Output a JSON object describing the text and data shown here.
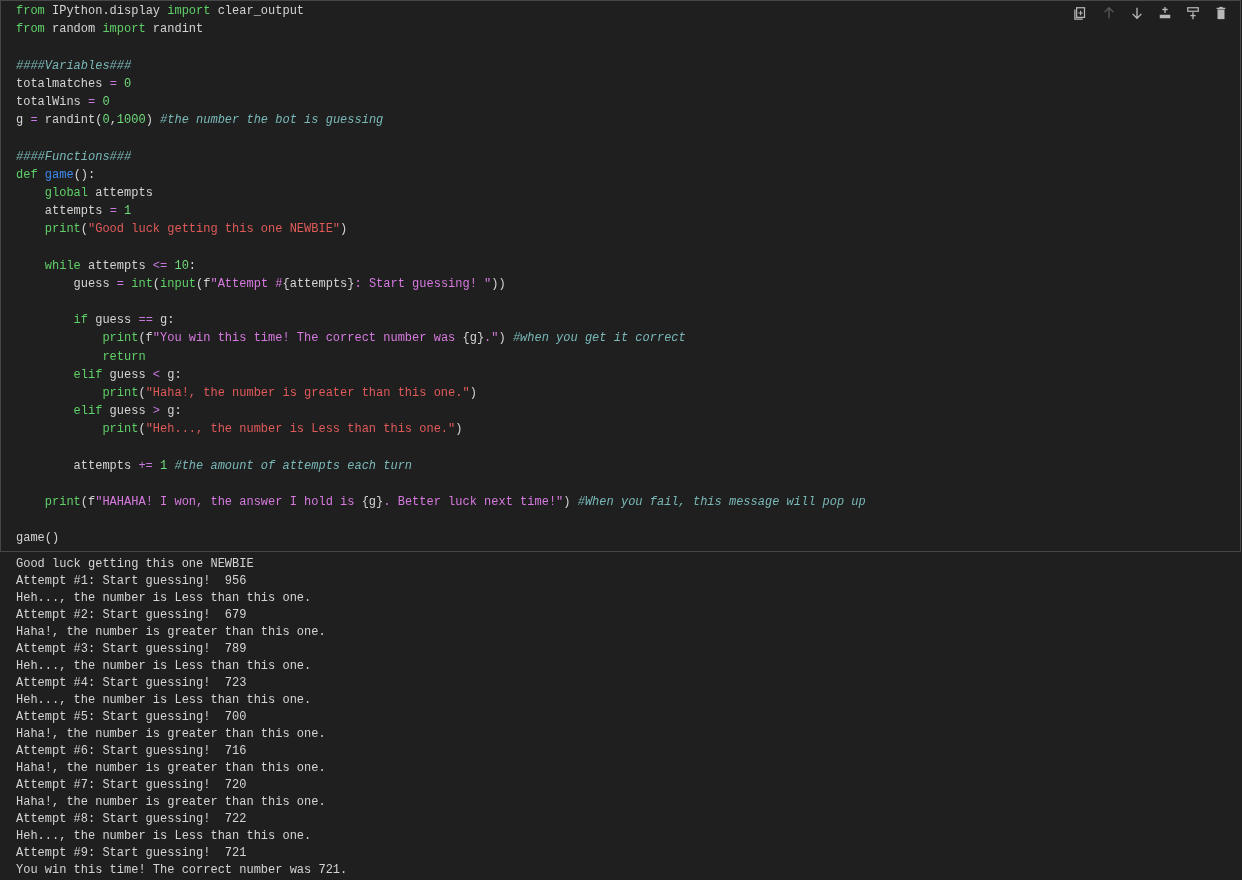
{
  "cell_toolbar": [
    {
      "kind": "copy",
      "disabled": false
    },
    {
      "kind": "move-up",
      "disabled": true
    },
    {
      "kind": "move-down",
      "disabled": false
    },
    {
      "kind": "insert-above",
      "disabled": false
    },
    {
      "kind": "insert-below",
      "disabled": false
    },
    {
      "kind": "delete",
      "disabled": false
    }
  ],
  "code_lines": [
    {
      "kind": "code",
      "tokens": [
        {
          "kind": "kw",
          "text": "from"
        },
        {
          "kind": "plain",
          "text": " IPython.display "
        },
        {
          "kind": "kw",
          "text": "import"
        },
        {
          "kind": "plain",
          "text": " clear_output"
        }
      ]
    },
    {
      "kind": "code",
      "tokens": [
        {
          "kind": "kw",
          "text": "from"
        },
        {
          "kind": "plain",
          "text": " random "
        },
        {
          "kind": "kw",
          "text": "import"
        },
        {
          "kind": "plain",
          "text": " randint"
        }
      ]
    },
    {
      "kind": "blank"
    },
    {
      "kind": "code",
      "tokens": [
        {
          "kind": "comment",
          "text": "####Variables###"
        }
      ]
    },
    {
      "kind": "code",
      "tokens": [
        {
          "kind": "plain",
          "text": "totalmatches "
        },
        {
          "kind": "op",
          "text": "="
        },
        {
          "kind": "num",
          "text": " 0"
        }
      ]
    },
    {
      "kind": "code",
      "tokens": [
        {
          "kind": "plain",
          "text": "totalWins "
        },
        {
          "kind": "op",
          "text": "="
        },
        {
          "kind": "num",
          "text": " 0"
        }
      ]
    },
    {
      "kind": "code",
      "tokens": [
        {
          "kind": "plain",
          "text": "g "
        },
        {
          "kind": "op",
          "text": "="
        },
        {
          "kind": "plain",
          "text": " randint("
        },
        {
          "kind": "num",
          "text": "0"
        },
        {
          "kind": "plain",
          "text": ","
        },
        {
          "kind": "num",
          "text": "1000"
        },
        {
          "kind": "plain",
          "text": ") "
        },
        {
          "kind": "comment",
          "text": "#the number the bot is guessing"
        }
      ]
    },
    {
      "kind": "blank"
    },
    {
      "kind": "code",
      "tokens": [
        {
          "kind": "comment",
          "text": "####Functions###"
        }
      ]
    },
    {
      "kind": "code",
      "tokens": [
        {
          "kind": "kw",
          "text": "def"
        },
        {
          "kind": "fn",
          "text": " game"
        },
        {
          "kind": "plain",
          "text": "():"
        }
      ]
    },
    {
      "kind": "code",
      "tokens": [
        {
          "kind": "kw",
          "text": "    global"
        },
        {
          "kind": "plain",
          "text": " attempts"
        }
      ]
    },
    {
      "kind": "code",
      "tokens": [
        {
          "kind": "plain",
          "text": "    attempts "
        },
        {
          "kind": "op",
          "text": "="
        },
        {
          "kind": "num",
          "text": " 1"
        }
      ]
    },
    {
      "kind": "code",
      "tokens": [
        {
          "kind": "kw",
          "text": "    print"
        },
        {
          "kind": "plain",
          "text": "("
        },
        {
          "kind": "str",
          "text": "\"Good luck getting this one NEWBIE\""
        },
        {
          "kind": "plain",
          "text": ")"
        }
      ]
    },
    {
      "kind": "blank"
    },
    {
      "kind": "code",
      "tokens": [
        {
          "kind": "kw",
          "text": "    while"
        },
        {
          "kind": "plain",
          "text": " attempts "
        },
        {
          "kind": "op",
          "text": "<="
        },
        {
          "kind": "num",
          "text": " 10"
        },
        {
          "kind": "plain",
          "text": ":"
        }
      ]
    },
    {
      "kind": "code",
      "tokens": [
        {
          "kind": "plain",
          "text": "        guess "
        },
        {
          "kind": "op",
          "text": "="
        },
        {
          "kind": "kw",
          "text": " int"
        },
        {
          "kind": "plain",
          "text": "("
        },
        {
          "kind": "kw",
          "text": "input"
        },
        {
          "kind": "plain",
          "text": "(f"
        },
        {
          "kind": "fstr",
          "text": "\"Attempt #"
        },
        {
          "kind": "plain",
          "text": "{attempts}"
        },
        {
          "kind": "fstr",
          "text": ": Start guessing! \""
        },
        {
          "kind": "plain",
          "text": "))"
        }
      ]
    },
    {
      "kind": "blank"
    },
    {
      "kind": "code",
      "tokens": [
        {
          "kind": "kw",
          "text": "        if"
        },
        {
          "kind": "plain",
          "text": " guess "
        },
        {
          "kind": "op",
          "text": "=="
        },
        {
          "kind": "plain",
          "text": " g:"
        }
      ]
    },
    {
      "kind": "code",
      "tokens": [
        {
          "kind": "kw",
          "text": "            print"
        },
        {
          "kind": "plain",
          "text": "(f"
        },
        {
          "kind": "fstr",
          "text": "\"You win this time! The correct number was "
        },
        {
          "kind": "plain",
          "text": "{g}"
        },
        {
          "kind": "fstr",
          "text": ".\""
        },
        {
          "kind": "plain",
          "text": ") "
        },
        {
          "kind": "comment",
          "text": "#when you get it correct"
        }
      ]
    },
    {
      "kind": "code",
      "tokens": [
        {
          "kind": "kw",
          "text": "            return"
        }
      ]
    },
    {
      "kind": "code",
      "tokens": [
        {
          "kind": "kw",
          "text": "        elif"
        },
        {
          "kind": "plain",
          "text": " guess "
        },
        {
          "kind": "op",
          "text": "<"
        },
        {
          "kind": "plain",
          "text": " g:"
        }
      ]
    },
    {
      "kind": "code",
      "tokens": [
        {
          "kind": "kw",
          "text": "            print"
        },
        {
          "kind": "plain",
          "text": "("
        },
        {
          "kind": "str",
          "text": "\"Haha!, the number is greater than this one.\""
        },
        {
          "kind": "plain",
          "text": ")"
        }
      ]
    },
    {
      "kind": "code",
      "tokens": [
        {
          "kind": "kw",
          "text": "        elif"
        },
        {
          "kind": "plain",
          "text": " guess "
        },
        {
          "kind": "op",
          "text": ">"
        },
        {
          "kind": "plain",
          "text": " g:"
        }
      ]
    },
    {
      "kind": "code",
      "tokens": [
        {
          "kind": "kw",
          "text": "            print"
        },
        {
          "kind": "plain",
          "text": "("
        },
        {
          "kind": "str",
          "text": "\"Heh..., the number is Less than this one.\""
        },
        {
          "kind": "plain",
          "text": ")"
        }
      ]
    },
    {
      "kind": "blank"
    },
    {
      "kind": "code",
      "tokens": [
        {
          "kind": "plain",
          "text": "        attempts "
        },
        {
          "kind": "op",
          "text": "+="
        },
        {
          "kind": "num",
          "text": " 1"
        },
        {
          "kind": "comment",
          "text": " #the amount of attempts each turn"
        }
      ]
    },
    {
      "kind": "blank"
    },
    {
      "kind": "code",
      "tokens": [
        {
          "kind": "kw",
          "text": "    print"
        },
        {
          "kind": "plain",
          "text": "(f"
        },
        {
          "kind": "fstr",
          "text": "\"HAHAHA! I won, the answer I hold is "
        },
        {
          "kind": "plain",
          "text": "{g}"
        },
        {
          "kind": "fstr",
          "text": ". Better luck next time!\""
        },
        {
          "kind": "plain",
          "text": ") "
        },
        {
          "kind": "comment",
          "text": "#When you fail, this message will pop up"
        }
      ]
    },
    {
      "kind": "blank"
    },
    {
      "kind": "code",
      "tokens": [
        {
          "kind": "plain",
          "text": "game()"
        }
      ]
    }
  ],
  "output_lines": [
    "Good luck getting this one NEWBIE",
    "Attempt #1: Start guessing!  956",
    "Heh..., the number is Less than this one.",
    "Attempt #2: Start guessing!  679",
    "Haha!, the number is greater than this one.",
    "Attempt #3: Start guessing!  789",
    "Heh..., the number is Less than this one.",
    "Attempt #4: Start guessing!  723",
    "Heh..., the number is Less than this one.",
    "Attempt #5: Start guessing!  700",
    "Haha!, the number is greater than this one.",
    "Attempt #6: Start guessing!  716",
    "Haha!, the number is greater than this one.",
    "Attempt #7: Start guessing!  720",
    "Haha!, the number is greater than this one.",
    "Attempt #8: Start guessing!  722",
    "Heh..., the number is Less than this one.",
    "Attempt #9: Start guessing!  721",
    "You win this time! The correct number was 721."
  ]
}
